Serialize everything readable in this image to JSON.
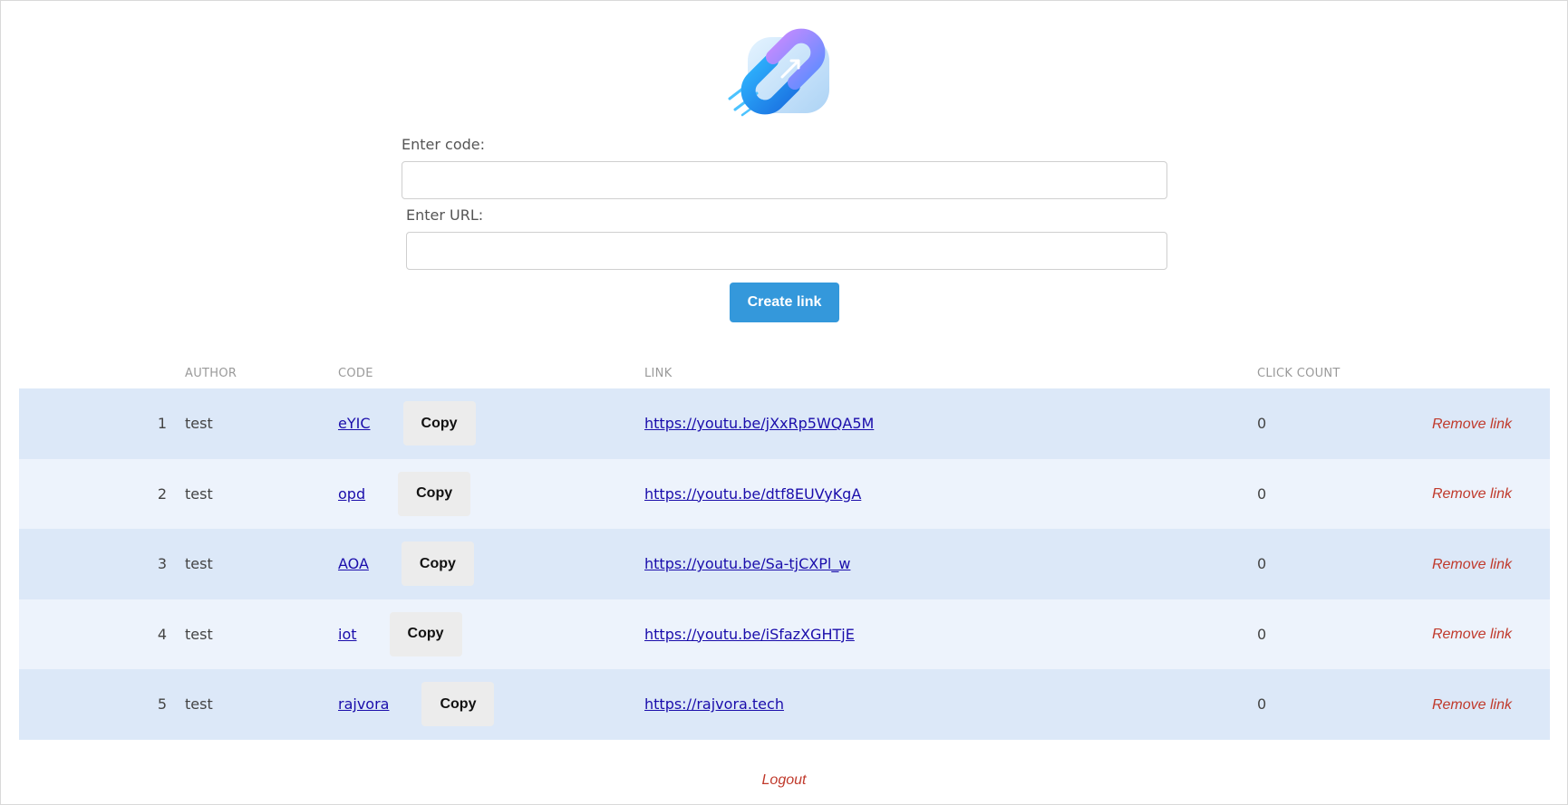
{
  "form": {
    "code_label": "Enter code:",
    "code_value": "",
    "url_label": "Enter URL:",
    "url_value": "",
    "create_label": "Create link"
  },
  "table": {
    "headers": {
      "author": "AUTHOR",
      "code": "CODE",
      "link": "LINK",
      "click_count": "CLICK COUNT"
    },
    "copy_label": "Copy",
    "remove_label": "Remove link",
    "rows": [
      {
        "num": "1",
        "author": "test",
        "code": "eYIC",
        "link": "https://youtu.be/jXxRp5WQA5M",
        "clicks": "0"
      },
      {
        "num": "2",
        "author": "test",
        "code": "opd",
        "link": "https://youtu.be/dtf8EUVyKgA",
        "clicks": "0"
      },
      {
        "num": "3",
        "author": "test",
        "code": "AOA",
        "link": "https://youtu.be/Sa-tjCXPl_w",
        "clicks": "0"
      },
      {
        "num": "4",
        "author": "test",
        "code": "iot",
        "link": "https://youtu.be/iSfazXGHTjE",
        "clicks": "0"
      },
      {
        "num": "5",
        "author": "test",
        "code": "rajvora",
        "link": "https://rajvora.tech",
        "clicks": "0"
      }
    ]
  },
  "footer": {
    "logout_label": "Logout"
  },
  "colors": {
    "primary": "#3498db",
    "danger": "#c0392b",
    "row_odd": "#dce8f8",
    "row_even": "#edf3fc"
  },
  "icons": {
    "logo": "chain-link-logo-icon"
  }
}
